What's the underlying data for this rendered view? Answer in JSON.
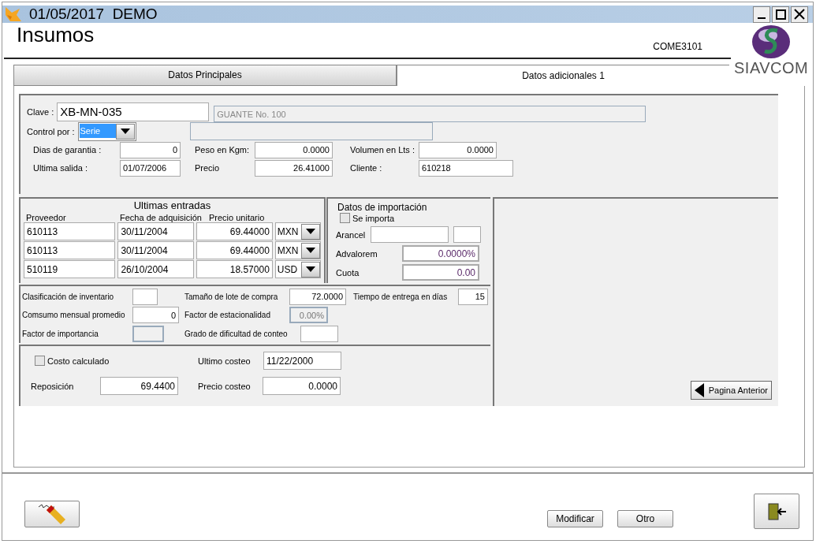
{
  "window": {
    "title": "01/05/2017  DEMO"
  },
  "header": {
    "title": "Insumos",
    "code": "COME3101",
    "logo_text": "SIAVCOM"
  },
  "tabs": [
    {
      "label": "Datos Principales",
      "selected": false
    },
    {
      "label": "Datos adicionales 1",
      "selected": true
    }
  ],
  "general": {
    "clave_label": "Clave :",
    "clave": "XB-MN-035",
    "description": "GUANTE No. 100",
    "control_label": "Control por :",
    "control": "Serie",
    "fields": [
      {
        "label": "Dias de garantia :",
        "value": "0"
      },
      {
        "label": "Peso en Kgm:",
        "value": "0.0000"
      },
      {
        "label": "Volumen en Lts :",
        "value": "0.0000"
      },
      {
        "label": "Ultima salida :",
        "value": "01/07/2006"
      },
      {
        "label": "Precio",
        "value": "26.41000"
      },
      {
        "label": "Cliente :",
        "value": "610218"
      }
    ]
  },
  "ultimas_entradas": {
    "title": "Ultimas entradas",
    "columns": [
      "Proveedor",
      "Fecha de adquisición",
      "Precio unitario"
    ],
    "rows": [
      {
        "proveedor": "610113",
        "fecha": "30/11/2004",
        "precio": "69.44000",
        "moneda": "MXN"
      },
      {
        "proveedor": "610113",
        "fecha": "30/11/2004",
        "precio": "69.44000",
        "moneda": "MXN"
      },
      {
        "proveedor": "510119",
        "fecha": "26/10/2004",
        "precio": "18.57000",
        "moneda": "USD"
      }
    ]
  },
  "importacion": {
    "title": "Datos de importación",
    "se_importa": {
      "label": "Se importa",
      "checked": false
    },
    "arancel_label": "Arancel",
    "advalorem_label": "Advalorem",
    "advalorem": "0.0000%",
    "cuota_label": "Cuota",
    "cuota": "0.00"
  },
  "inventario": [
    {
      "label": "Clasificación de inventario",
      "disabled": false
    },
    {
      "label": "Tamaño de lote de compra",
      "value": "72.0000",
      "disabled": false
    },
    {
      "label": "Tiempo de entrega en días",
      "value": "15",
      "disabled": false
    },
    {
      "label": "Comsumo mensual promedio",
      "value": "0",
      "disabled": false
    },
    {
      "label": "Factor de estacionalidad",
      "value": "0.00%",
      "disabled": true
    },
    {
      "label": "Factor de importancia",
      "disabled": true
    },
    {
      "label": "Grado de dificultad de conteo",
      "disabled": false
    }
  ],
  "costeo": {
    "costo_calculado": {
      "label": "Costo calculado",
      "checked": false
    },
    "ultimo_costeo_label": "Ultimo costeo",
    "ultimo_costeo": "11/22/2000",
    "reposicion_label": "Reposición",
    "reposicion": "69.4400",
    "precio_costeo_label": "Precio costeo",
    "precio_costeo": "0.0000"
  },
  "buttons": {
    "pagina_anterior": "Pagina Anterior",
    "modificar": "Modificar",
    "otro": "Otro"
  }
}
